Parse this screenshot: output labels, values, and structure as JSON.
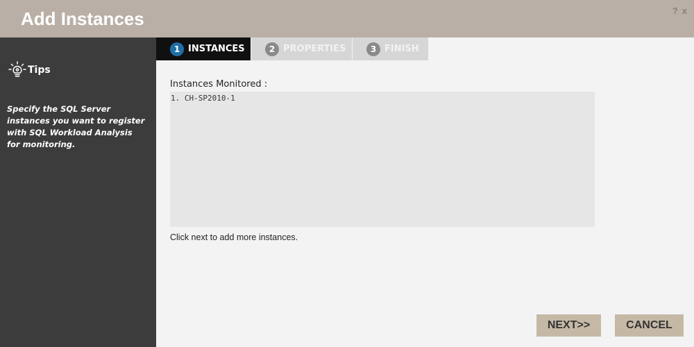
{
  "window": {
    "title": "Add Instances",
    "help_label": "?",
    "close_label": "x"
  },
  "sidebar": {
    "tips_label": "Tips",
    "tips_text": "Specify the SQL Server instances you want to register with SQL Workload Analysis for monitoring."
  },
  "steps": [
    {
      "number": "1",
      "label": "INSTANCES",
      "state": "active"
    },
    {
      "number": "2",
      "label": "PROPERTIES",
      "state": "inactive"
    },
    {
      "number": "3",
      "label": "FINISH",
      "state": "inactive"
    }
  ],
  "main": {
    "monitored_label": "Instances Monitored :",
    "instances": [
      "1. CH-SP2010-1"
    ],
    "hint": "Click next to add more instances."
  },
  "buttons": {
    "next_label": "NEXT>>",
    "cancel_label": "CANCEL"
  },
  "colors": {
    "titlebar": "#b9afa6",
    "sidebar": "#3c3c3c",
    "active_step": "#101010",
    "active_step_number": "#1f6ea5",
    "button": "#c5b9a6"
  }
}
